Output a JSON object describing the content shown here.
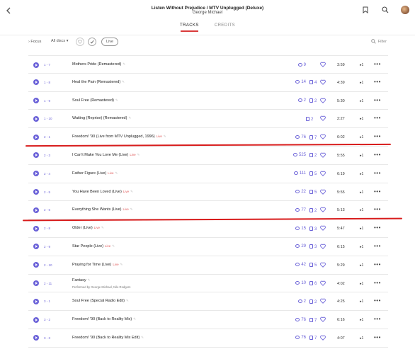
{
  "header": {
    "back_icon": "chevron-left-icon",
    "title": "Listen Without Prejudice / MTV Unplugged (Deluxe)",
    "artist": "George Michael",
    "tabs": [
      {
        "label": "TRACKS",
        "active": true
      },
      {
        "label": "CREDITS",
        "active": false
      }
    ]
  },
  "filters": {
    "focus_label": "Focus",
    "discs_label": "All discs",
    "live_label": "Live",
    "filter_placeholder": "Filter"
  },
  "colors": {
    "accent": "#6b62d8",
    "live": "#e05a5a",
    "tab_underline": "#d93a3a",
    "annotation": "#d81c1c"
  },
  "tracks": [
    {
      "num": "1 - 7",
      "title": "Mothers Pride (Remastered)",
      "live": "",
      "performers": "",
      "plays": "9",
      "versions": "",
      "duration": "3:59",
      "exp": "1"
    },
    {
      "num": "1 - 8",
      "title": "Heal the Pain (Remastered)",
      "live": "",
      "performers": "",
      "plays": "14",
      "versions": "4",
      "duration": "4:39",
      "exp": "1"
    },
    {
      "num": "1 - 9",
      "title": "Soul Free (Remastered)",
      "live": "",
      "performers": "",
      "plays": "2",
      "versions": "2",
      "duration": "5:30",
      "exp": "1"
    },
    {
      "num": "1 - 10",
      "title": "Waiting (Reprise) (Remastered)",
      "live": "",
      "performers": "",
      "plays": "",
      "versions": "2",
      "duration": "2:27",
      "exp": "1"
    },
    {
      "num": "2 - 1",
      "title": "Freedom! '90 (Live from MTV Unplugged, 1996)",
      "live": "Live",
      "performers": "",
      "plays": "76",
      "versions": "7",
      "duration": "6:02",
      "exp": "1"
    },
    {
      "num": "2 - 3",
      "title": "I Can't Make You Love Me (Live)",
      "live": "Live",
      "performers": "",
      "plays": "525",
      "versions": "2",
      "duration": "5:55",
      "exp": "1"
    },
    {
      "num": "2 - 4",
      "title": "Father Figure (Live)",
      "live": "Live",
      "performers": "",
      "plays": "111",
      "versions": "5",
      "duration": "6:19",
      "exp": "1"
    },
    {
      "num": "2 - 5",
      "title": "You Have Been Loved (Live)",
      "live": "Live",
      "performers": "",
      "plays": "22",
      "versions": "5",
      "duration": "5:55",
      "exp": "1"
    },
    {
      "num": "2 - 6",
      "title": "Everything She Wants (Live)",
      "live": "Live",
      "performers": "",
      "plays": "77",
      "versions": "2",
      "duration": "5:13",
      "exp": "1"
    },
    {
      "num": "2 - 8",
      "title": "Older (Live)",
      "live": "Live",
      "performers": "",
      "plays": "15",
      "versions": "3",
      "duration": "5:47",
      "exp": "1"
    },
    {
      "num": "2 - 9",
      "title": "Star People (Live)",
      "live": "Live",
      "performers": "",
      "plays": "29",
      "versions": "3",
      "duration": "6:15",
      "exp": "1"
    },
    {
      "num": "2 - 10",
      "title": "Praying for Time (Live)",
      "live": "Live",
      "performers": "",
      "plays": "42",
      "versions": "5",
      "duration": "5:29",
      "exp": "1"
    },
    {
      "num": "2 - 11",
      "title": "Fantasy",
      "live": "",
      "performers": "Performed by George Michael, Nile Rodgers",
      "plays": "10",
      "versions": "6",
      "duration": "4:02",
      "exp": "1"
    },
    {
      "num": "3 - 1",
      "title": "Soul Free (Special Radio Edit)",
      "live": "",
      "performers": "",
      "plays": "2",
      "versions": "2",
      "duration": "4:25",
      "exp": "1"
    },
    {
      "num": "3 - 2",
      "title": "Freedom! '90 (Back to Reality Mix)",
      "live": "",
      "performers": "",
      "plays": "76",
      "versions": "7",
      "duration": "6:16",
      "exp": "1"
    },
    {
      "num": "3 - 3",
      "title": "Freedom! '90 (Back to Reality Mix Edit)",
      "live": "",
      "performers": "",
      "plays": "76",
      "versions": "7",
      "duration": "4:07",
      "exp": "1"
    }
  ]
}
